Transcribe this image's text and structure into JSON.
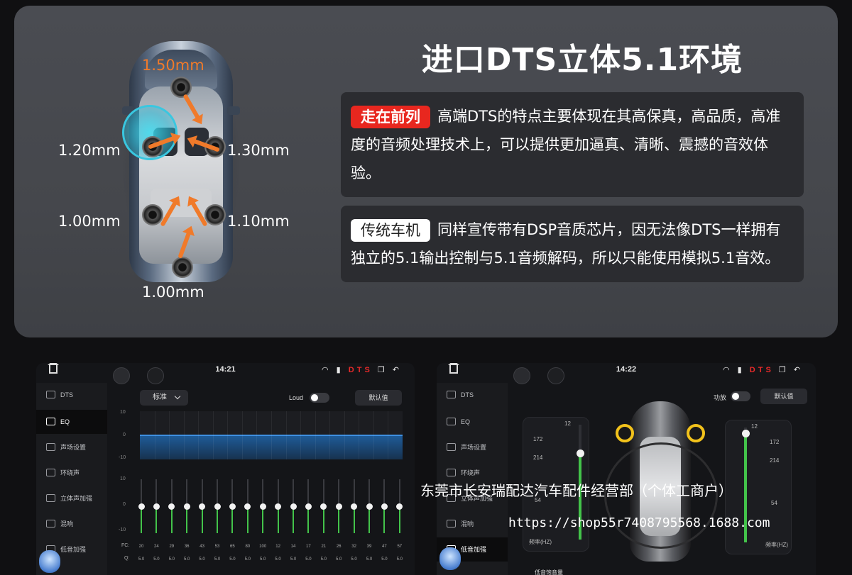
{
  "promo": {
    "title": "进口DTS立体5.1环境",
    "dims": {
      "front": "1.50mm",
      "left_front": "1.20mm",
      "right_front": "1.30mm",
      "left_rear": "1.00mm",
      "right_rear": "1.10mm",
      "rear": "1.00mm"
    },
    "cards": [
      {
        "badge": "走在前列",
        "text": "高端DTS的特点主要体现在其高保真，高品质，高准度的音频处理技术上，可以提供更加逼真、清晰、震撼的音效体验。"
      },
      {
        "badge": "传统车机",
        "text": "同样宣传带有DSP音质芯片，因无法像DTS一样拥有独立的5.1输出控制与5.1音频解码，所以只能使用模拟5.1音效。"
      }
    ]
  },
  "screen_left": {
    "time": "14:21",
    "status_icons": "DTS",
    "sidebar": [
      {
        "label": "DTS"
      },
      {
        "label": "EQ"
      },
      {
        "label": "声场设置"
      },
      {
        "label": "环绕声"
      },
      {
        "label": "立体声加强"
      },
      {
        "label": "混响"
      },
      {
        "label": "低音加强"
      }
    ],
    "preset": "标准",
    "loud_label": "Loud",
    "default_label": "默认值",
    "graph_axis": [
      "10",
      "0",
      "-10"
    ],
    "slider_axis": [
      "10",
      "0",
      "-10"
    ],
    "fc_label": "FC:",
    "q_label": "Q:",
    "bands": [
      "20",
      "24",
      "29",
      "36",
      "43",
      "53",
      "65",
      "80",
      "100",
      "12",
      "14",
      "17",
      "21",
      "26",
      "32",
      "39",
      "47",
      "57"
    ],
    "q_values": [
      "5.0",
      "5.0",
      "5.0",
      "5.0",
      "5.0",
      "5.0",
      "5.0",
      "5.0",
      "5.0",
      "5.0",
      "5.0",
      "5.0",
      "5.0",
      "5.0",
      "5.0",
      "5.0",
      "5.0",
      "5.0"
    ],
    "band_gains": [
      0,
      0,
      0,
      0,
      0,
      0,
      0,
      0,
      0,
      0,
      0,
      0,
      0,
      0,
      0,
      0,
      0,
      0
    ]
  },
  "screen_right": {
    "time": "14:22",
    "sidebar": [
      {
        "label": "DTS"
      },
      {
        "label": "EQ"
      },
      {
        "label": "声场设置"
      },
      {
        "label": "环绕声"
      },
      {
        "label": "立体声加强"
      },
      {
        "label": "混响"
      },
      {
        "label": "低音加强"
      }
    ],
    "power_label": "功放",
    "default_label": "默认值",
    "left_dial": {
      "top": "12",
      "nums": [
        "172",
        "214",
        "54"
      ],
      "footer": "频率(HZ)",
      "level": 0.75
    },
    "right_dial": {
      "top": "12",
      "nums": [
        "172",
        "214",
        "54"
      ],
      "footer": "频率(HZ)",
      "level": 0.95
    },
    "bottom_label": "低音饱音量"
  },
  "overlay": {
    "shop_name": "东莞市长安瑞配达汽车配件经营部（个体工商户）",
    "shop_url": "https://shop55r7408795568.1688.com"
  },
  "colors": {
    "accent_red": "#e8271f",
    "slider_green": "#43c34a",
    "glow_cyan": "#39c7e0",
    "arrow_orange": "#f07a2a"
  }
}
